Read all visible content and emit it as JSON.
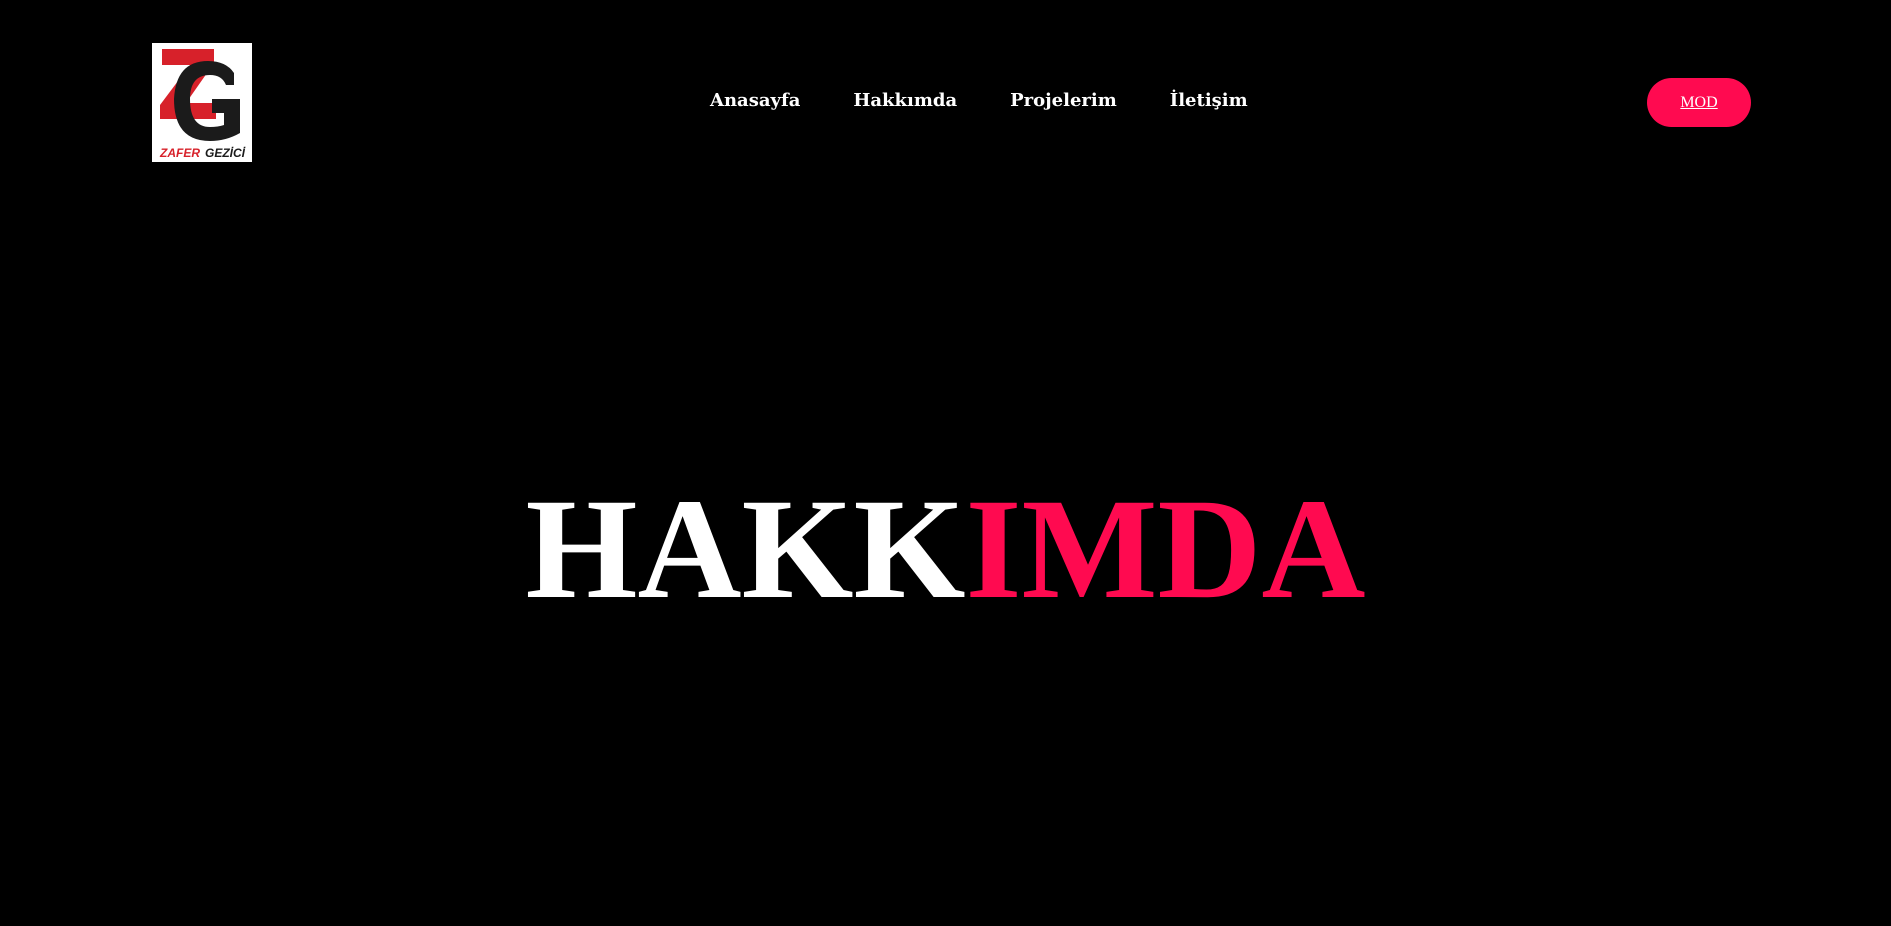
{
  "logo": {
    "lettering": "ZG",
    "caption_red": "ZAFER",
    "caption_dark": "GEZİCİ"
  },
  "nav": {
    "items": [
      {
        "label": "Anasayfa"
      },
      {
        "label": "Hakkımda"
      },
      {
        "label": "Projelerim"
      },
      {
        "label": "İletişim"
      }
    ]
  },
  "mode_button": {
    "label": "MOD"
  },
  "hero": {
    "title_white": "HAKK",
    "title_accent": "IMDA"
  },
  "colors": {
    "background": "#000000",
    "text": "#ffffff",
    "accent": "#ff0a50",
    "logo_red": "#d7212a",
    "logo_dark": "#1b1b1b"
  }
}
